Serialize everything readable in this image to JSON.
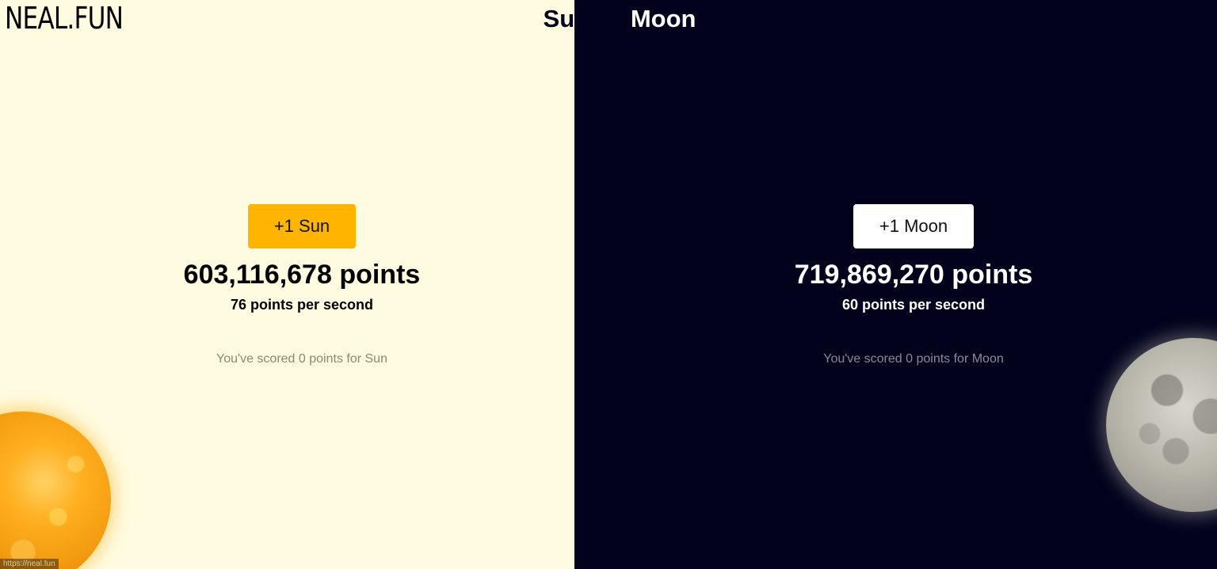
{
  "logo": "NEAL.FUN",
  "title": {
    "part_dark": "Sun vs ",
    "part_light": "Moon"
  },
  "sun": {
    "button_label": "+1 Sun",
    "points": "603,116,678 points",
    "per_second": "76 points per second",
    "scored": "You've scored 0 points for Sun"
  },
  "moon": {
    "button_label": "+1 Moon",
    "points": "719,869,270 points",
    "per_second": "60 points per second",
    "scored": "You've scored 0 points for Moon"
  },
  "status_url": "https://neal.fun",
  "colors": {
    "sun_background": "#fffbe0",
    "moon_background": "#02021c",
    "sun_button": "#ffb400",
    "moon_button": "#ffffff"
  }
}
